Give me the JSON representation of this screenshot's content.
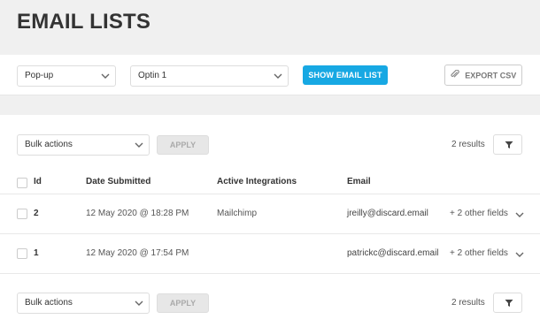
{
  "page": {
    "title": "EMAIL LISTS"
  },
  "filters": {
    "type_select": "Pop-up",
    "module_select": "Optin 1",
    "show_button": "SHOW EMAIL LIST",
    "export_button": "EXPORT CSV"
  },
  "top_actions": {
    "bulk_select": "Bulk actions",
    "apply_button": "APPLY",
    "results": "2 results"
  },
  "table": {
    "columns": [
      "Id",
      "Date Submitted",
      "Active Integrations",
      "Email"
    ],
    "rows": [
      {
        "id": "2",
        "date": "12 May 2020 @ 18:28 PM",
        "integration": "Mailchimp",
        "email": "jreilly@discard.email",
        "more": "+ 2 other fields"
      },
      {
        "id": "1",
        "date": "12 May 2020 @ 17:54 PM",
        "integration": "",
        "email": "patrickc@discard.email",
        "more": "+ 2 other fields"
      }
    ]
  },
  "bottom_actions": {
    "bulk_select": "Bulk actions",
    "apply_button": "APPLY",
    "results": "2 results"
  },
  "colors": {
    "accent": "#17a8e3",
    "header_bg": "#f0f0f0"
  }
}
